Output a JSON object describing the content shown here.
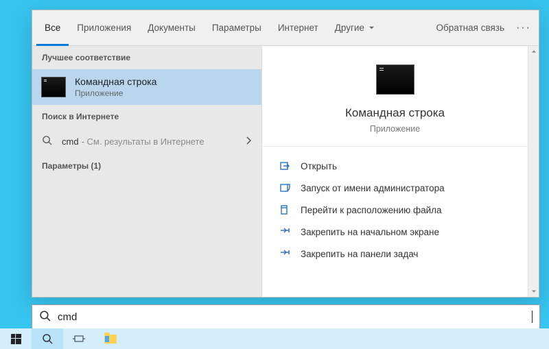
{
  "tabs": {
    "all": "Все",
    "apps": "Приложения",
    "docs": "Документы",
    "settings": "Параметры",
    "internet": "Интернет",
    "other": "Другие"
  },
  "header": {
    "feedback": "Обратная связь"
  },
  "sections": {
    "best_match": "Лучшее соответствие",
    "web": "Поиск в Интернете",
    "settings": "Параметры (1)"
  },
  "best_match": {
    "title": "Командная строка",
    "subtitle": "Приложение"
  },
  "web": {
    "query": "cmd",
    "hint": " - См. результаты в Интернете"
  },
  "preview": {
    "title": "Командная строка",
    "subtitle": "Приложение"
  },
  "actions": {
    "open": "Открыть",
    "run_admin": "Запуск от имени администратора",
    "open_location": "Перейти к расположению файла",
    "pin_start": "Закрепить на начальном экране",
    "pin_taskbar": "Закрепить на панели задач"
  },
  "search_value": "cmd"
}
